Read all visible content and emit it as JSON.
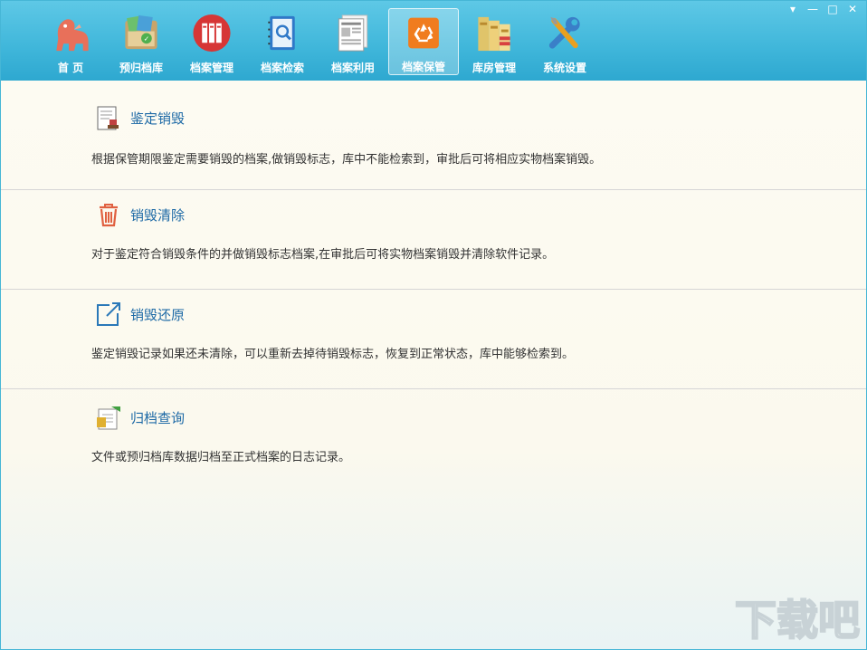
{
  "toolbar": {
    "items": [
      {
        "label": "首  页",
        "icon": "home-dinosaur-icon"
      },
      {
        "label": "预归档库",
        "icon": "pre-archive-icon"
      },
      {
        "label": "档案管理",
        "icon": "archive-management-icon"
      },
      {
        "label": "档案检索",
        "icon": "archive-search-icon"
      },
      {
        "label": "档案利用",
        "icon": "archive-use-icon"
      },
      {
        "label": "档案保管",
        "icon": "archive-keeping-icon",
        "active": true
      },
      {
        "label": "库房管理",
        "icon": "warehouse-icon"
      },
      {
        "label": "系统设置",
        "icon": "settings-tools-icon"
      }
    ],
    "window": {
      "menu": "▾",
      "minimize": "—",
      "maximize": "□",
      "close": "✕"
    }
  },
  "sections": [
    {
      "title": "鉴定销毁",
      "icon": "appraisal-stamp-icon",
      "desc": "根据保管期限鉴定需要销毁的档案,做销毁标志，库中不能检索到，审批后可将相应实物档案销毁。"
    },
    {
      "title": "销毁清除",
      "icon": "trash-icon",
      "desc": "对于鉴定符合销毁条件的并做销毁标志档案,在审批后可将实物档案销毁并清除软件记录。"
    },
    {
      "title": "销毁还原",
      "icon": "restore-icon",
      "desc": "鉴定销毁记录如果还未清除，可以重新去掉待销毁标志，恢复到正常状态，库中能够检索到。"
    },
    {
      "title": "归档查询",
      "icon": "archive-query-icon",
      "desc": "文件或预归档库数据归档至正式档案的日志记录。"
    }
  ],
  "watermark": {
    "text": "下载吧"
  },
  "colors": {
    "toolbar": "#3fb6da",
    "title": "#1e6aa6",
    "text": "#333333"
  }
}
